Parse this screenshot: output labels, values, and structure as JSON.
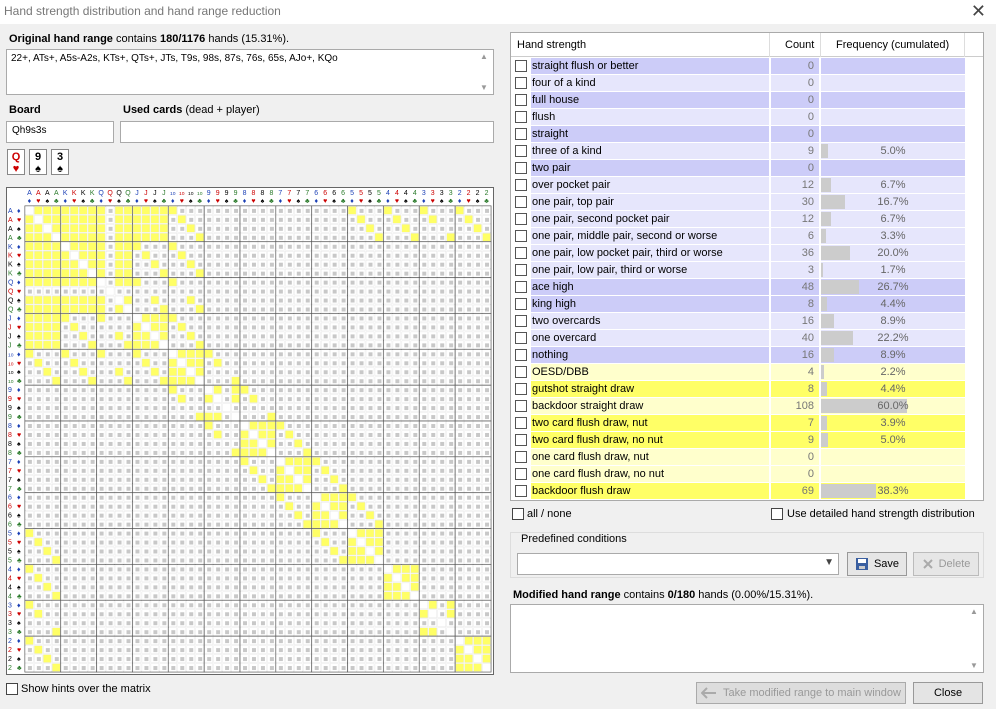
{
  "window": {
    "title": "Hand strength distribution and hand range reduction",
    "close_glyph": "✕"
  },
  "original": {
    "label": "Original hand range",
    "text": " contains ",
    "count": "180/1176",
    "rest": " hands (15.31%).",
    "range": "22+, ATs+, A5s-A2s, KTs+, QTs+, JTs, T9s, 98s, 87s, 76s, 65s, AJo+, KQo"
  },
  "board": {
    "label": "Board",
    "value": "Qh9s3s",
    "used_label": "Used cards",
    "used_hint": " (dead + player)"
  },
  "board_cards": [
    {
      "rank": "Q",
      "suit": "♥",
      "color": "red"
    },
    {
      "rank": "9",
      "suit": "♠",
      "color": "blk"
    },
    {
      "rank": "3",
      "suit": "♠",
      "color": "blk"
    }
  ],
  "matrix": {
    "ranks": [
      "A",
      "K",
      "Q",
      "J",
      "10",
      "9",
      "8",
      "7",
      "6",
      "5",
      "4",
      "3",
      "2"
    ],
    "suits": [
      "♦",
      "♥",
      "♠",
      "♣"
    ],
    "suit_colors": [
      "#1a3fb5",
      "#c00",
      "#000",
      "#2a7a2a"
    ],
    "highlight_color": "#ffff66",
    "dead_color": "#c8c8c8"
  },
  "hints": {
    "label": "Show hints over the matrix"
  },
  "table": {
    "headers": {
      "name": "Hand strength",
      "count": "Count",
      "freq": "Frequency (cumulated)"
    },
    "rows": [
      {
        "name": "straight flush or better",
        "count": "0",
        "freq": "",
        "pct": 0,
        "bg": "#ccccf8"
      },
      {
        "name": "four of a kind",
        "count": "0",
        "freq": "",
        "pct": 0,
        "bg": "#e6e6fc"
      },
      {
        "name": "full house",
        "count": "0",
        "freq": "",
        "pct": 0,
        "bg": "#ccccf8"
      },
      {
        "name": "flush",
        "count": "0",
        "freq": "",
        "pct": 0,
        "bg": "#e6e6fc"
      },
      {
        "name": "straight",
        "count": "0",
        "freq": "",
        "pct": 0,
        "bg": "#ccccf8"
      },
      {
        "name": "three of a kind",
        "count": "9",
        "freq": "5.0%",
        "pct": 5.0,
        "bg": "#e6e6fc"
      },
      {
        "name": "two pair",
        "count": "0",
        "freq": "",
        "pct": 0,
        "bg": "#ccccf8"
      },
      {
        "name": "over pocket pair",
        "count": "12",
        "freq": "6.7%",
        "pct": 6.7,
        "bg": "#e6e6fc"
      },
      {
        "name": "one pair, top pair",
        "count": "30",
        "freq": "16.7%",
        "pct": 16.7,
        "bg": "#e6e6fc"
      },
      {
        "name": "one pair, second pocket pair",
        "count": "12",
        "freq": "6.7%",
        "pct": 6.7,
        "bg": "#e6e6fc"
      },
      {
        "name": "one pair, middle pair, second or worse",
        "count": "6",
        "freq": "3.3%",
        "pct": 3.3,
        "bg": "#e6e6fc"
      },
      {
        "name": "one pair, low pocket pair, third or worse",
        "count": "36",
        "freq": "20.0%",
        "pct": 20.0,
        "bg": "#e6e6fc"
      },
      {
        "name": "one pair, low pair, third or worse",
        "count": "3",
        "freq": "1.7%",
        "pct": 1.7,
        "bg": "#e6e6fc"
      },
      {
        "name": "ace high",
        "count": "48",
        "freq": "26.7%",
        "pct": 26.7,
        "bg": "#ccccf8"
      },
      {
        "name": "king high",
        "count": "8",
        "freq": "4.4%",
        "pct": 4.4,
        "bg": "#ccccf8"
      },
      {
        "name": "two overcards",
        "count": "16",
        "freq": "8.9%",
        "pct": 8.9,
        "bg": "#e6e6fc"
      },
      {
        "name": "one overcard",
        "count": "40",
        "freq": "22.2%",
        "pct": 22.2,
        "bg": "#e6e6fc"
      },
      {
        "name": "nothing",
        "count": "16",
        "freq": "8.9%",
        "pct": 8.9,
        "bg": "#ccccf8"
      },
      {
        "name": "OESD/DBB",
        "count": "4",
        "freq": "2.2%",
        "pct": 2.2,
        "bg": "#ffffcc"
      },
      {
        "name": "gutshot straight draw",
        "count": "8",
        "freq": "4.4%",
        "pct": 4.4,
        "bg": "#ffff66"
      },
      {
        "name": "backdoor straight draw",
        "count": "108",
        "freq": "60.0%",
        "pct": 60.0,
        "bg": "#ffffcc"
      },
      {
        "name": "two card flush draw, nut",
        "count": "7",
        "freq": "3.9%",
        "pct": 3.9,
        "bg": "#ffff66"
      },
      {
        "name": "two card flush draw, no nut",
        "count": "9",
        "freq": "5.0%",
        "pct": 5.0,
        "bg": "#ffff66"
      },
      {
        "name": "one card flush draw, nut",
        "count": "0",
        "freq": "",
        "pct": 0,
        "bg": "#ffffcc"
      },
      {
        "name": "one card flush draw, no nut",
        "count": "0",
        "freq": "",
        "pct": 0,
        "bg": "#ffffcc"
      },
      {
        "name": "backdoor flush draw",
        "count": "69",
        "freq": "38.3%",
        "pct": 38.3,
        "bg": "#ffff66"
      }
    ]
  },
  "options": {
    "all_none": "all / none",
    "detailed": "Use detailed hand strength distribution"
  },
  "predefined": {
    "label": "Predefined conditions",
    "save": "Save",
    "delete": "Delete"
  },
  "modified": {
    "label": "Modified hand range",
    "text": " contains ",
    "count": "0/180",
    "rest": " hands (0.00%/15.31%)."
  },
  "buttons": {
    "take": "Take modified range to main window",
    "close": "Close"
  }
}
